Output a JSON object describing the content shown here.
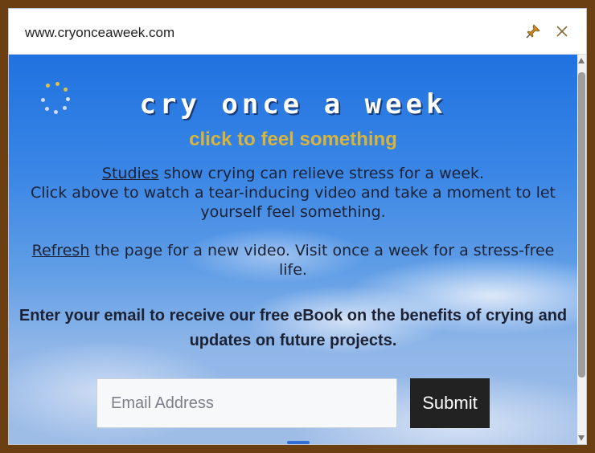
{
  "window": {
    "url": "www.cryonceaweek.com",
    "pin_icon": "pushpin-icon",
    "close_icon": "close-icon"
  },
  "page": {
    "title": "cry once a week",
    "cta": "click to feel something",
    "para1": {
      "link": "Studies",
      "rest": " show crying can relieve stress for a week.",
      "line2": "Click above to watch a tear-inducing video and take a moment to let yourself feel something."
    },
    "para2": {
      "link": "Refresh",
      "rest": " the page for a new video. Visit once a week for a stress-free life."
    },
    "signup_text": "Enter your email to receive our free eBook on the benefits of crying and updates on future projects.",
    "email_placeholder": "Email Address",
    "submit_label": "Submit"
  },
  "colors": {
    "accent": "#d9b43a",
    "sky_top": "#1f72e0",
    "button_bg": "#222222"
  }
}
